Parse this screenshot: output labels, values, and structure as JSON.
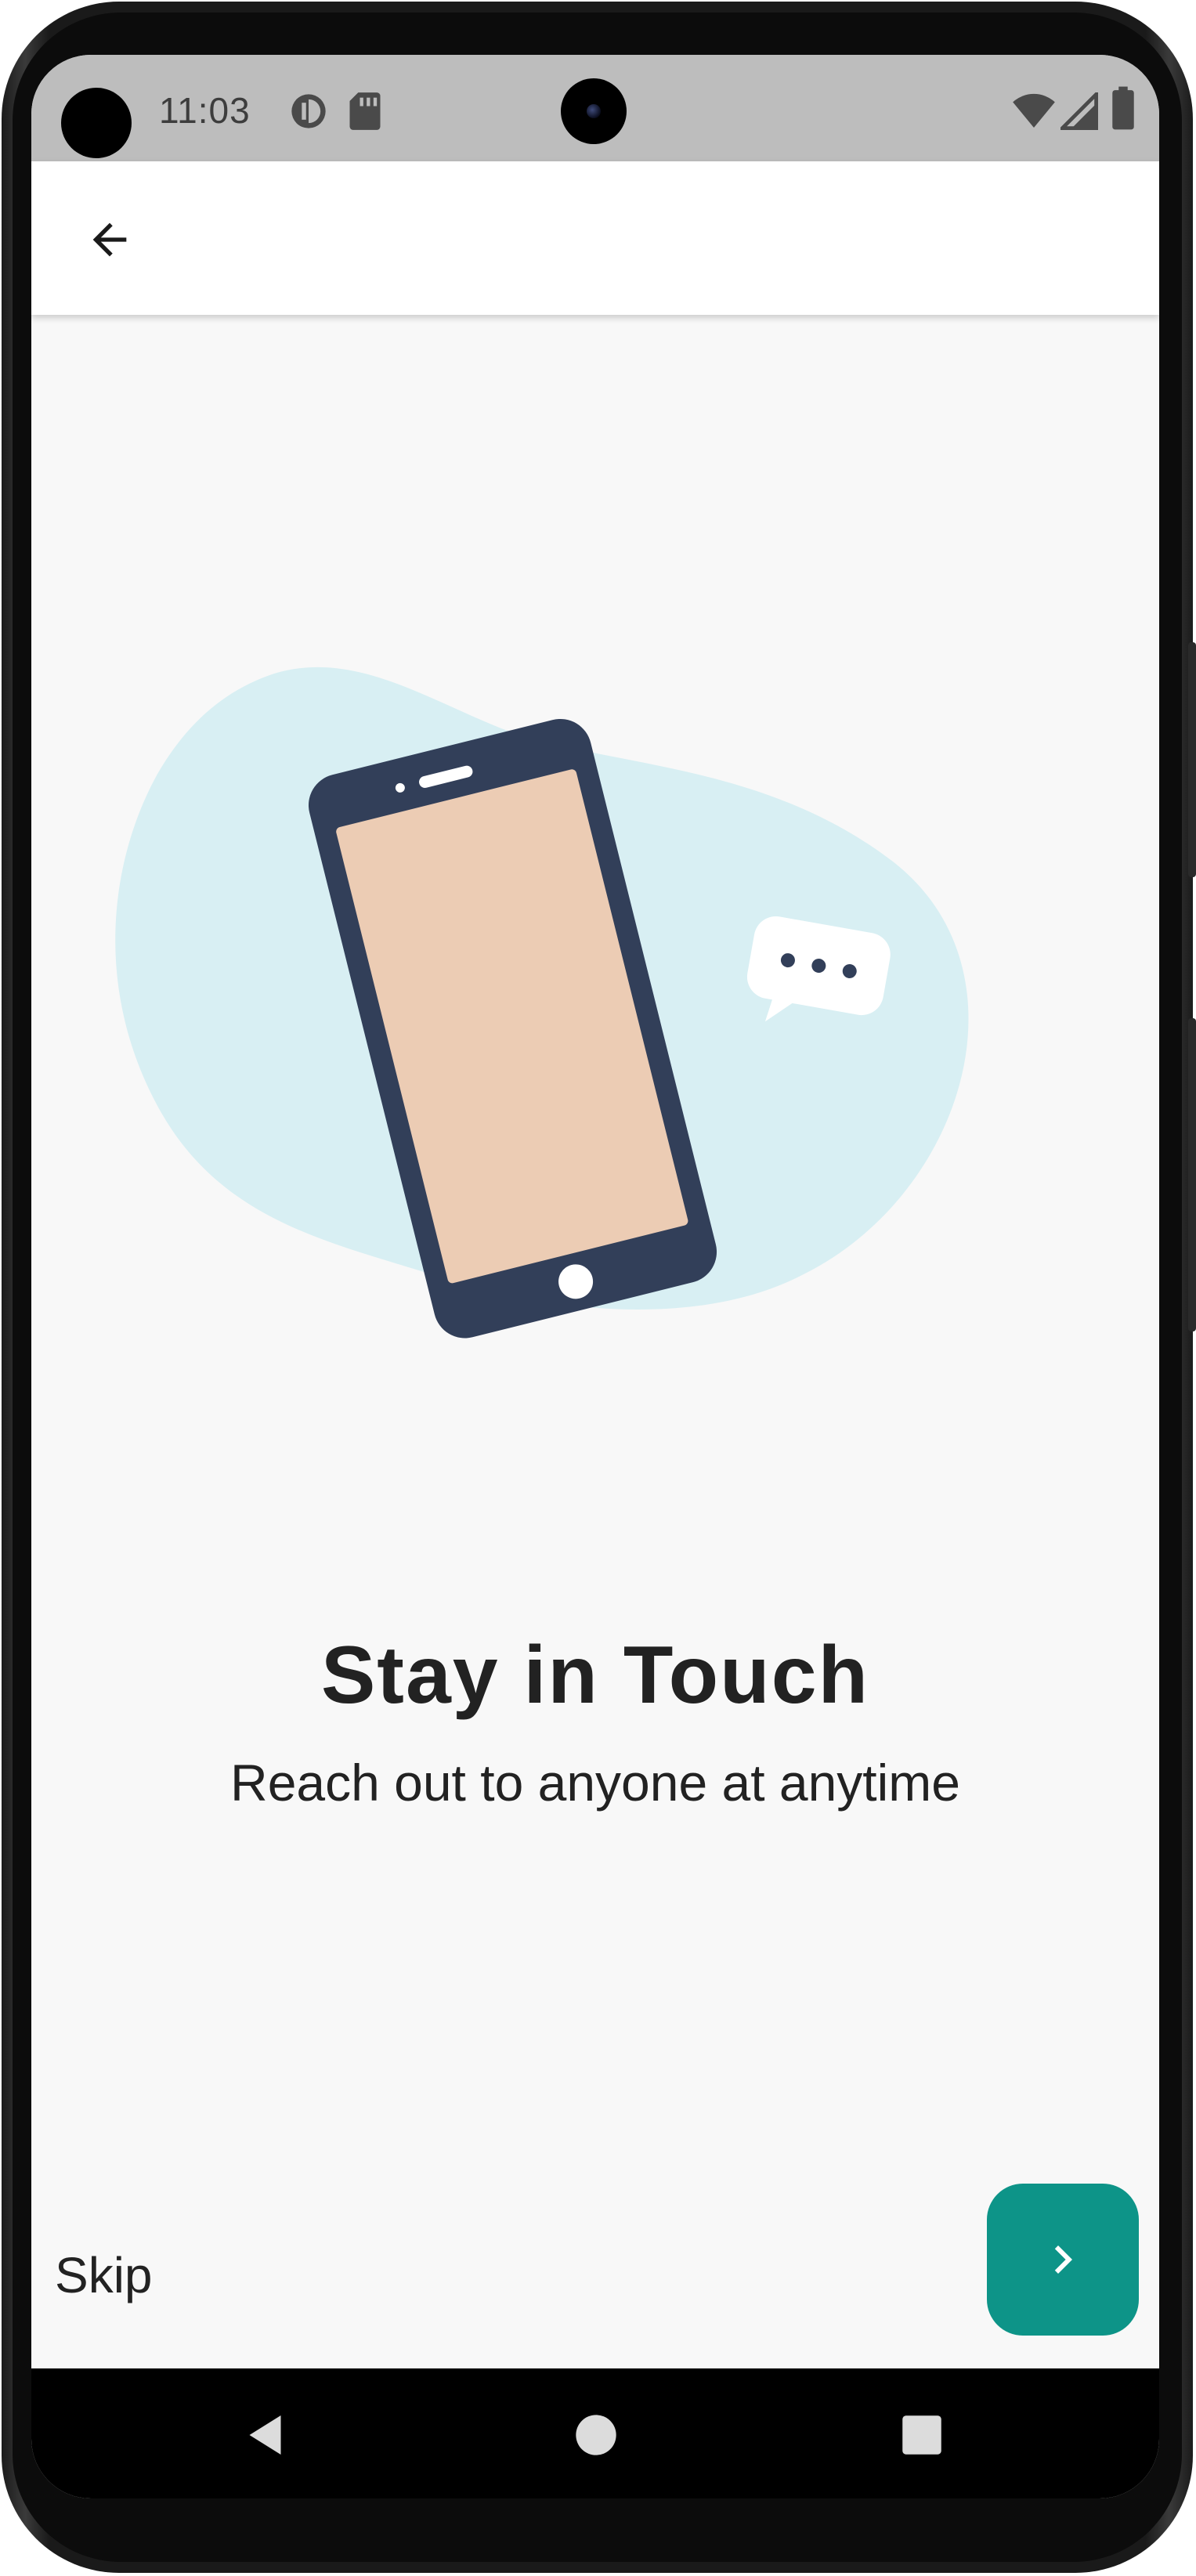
{
  "status_bar": {
    "time": "11:03",
    "left_icons": [
      "contrast-icon",
      "sd-card-icon"
    ],
    "right_icons": [
      "wifi-icon",
      "signal-icon",
      "battery-icon"
    ]
  },
  "app_bar": {
    "back_icon": "arrow-back-icon"
  },
  "onboarding": {
    "title": "Stay in Touch",
    "subtitle": "Reach out to anyone at anytime",
    "illustration": "phone-with-chat-bubble"
  },
  "footer": {
    "skip_label": "Skip",
    "next_icon": "chevron-right-icon"
  },
  "nav_bar": {
    "back_icon": "nav-back-icon",
    "home_icon": "nav-home-icon",
    "recents_icon": "nav-recents-icon"
  },
  "colors": {
    "accent": "#0d9488",
    "background": "#f8f8f8",
    "status_bar": "#bdbdbd",
    "text": "#222222",
    "phone_body": "#323f59",
    "phone_screen": "#ecccb4",
    "blob": "#d8eff3"
  }
}
